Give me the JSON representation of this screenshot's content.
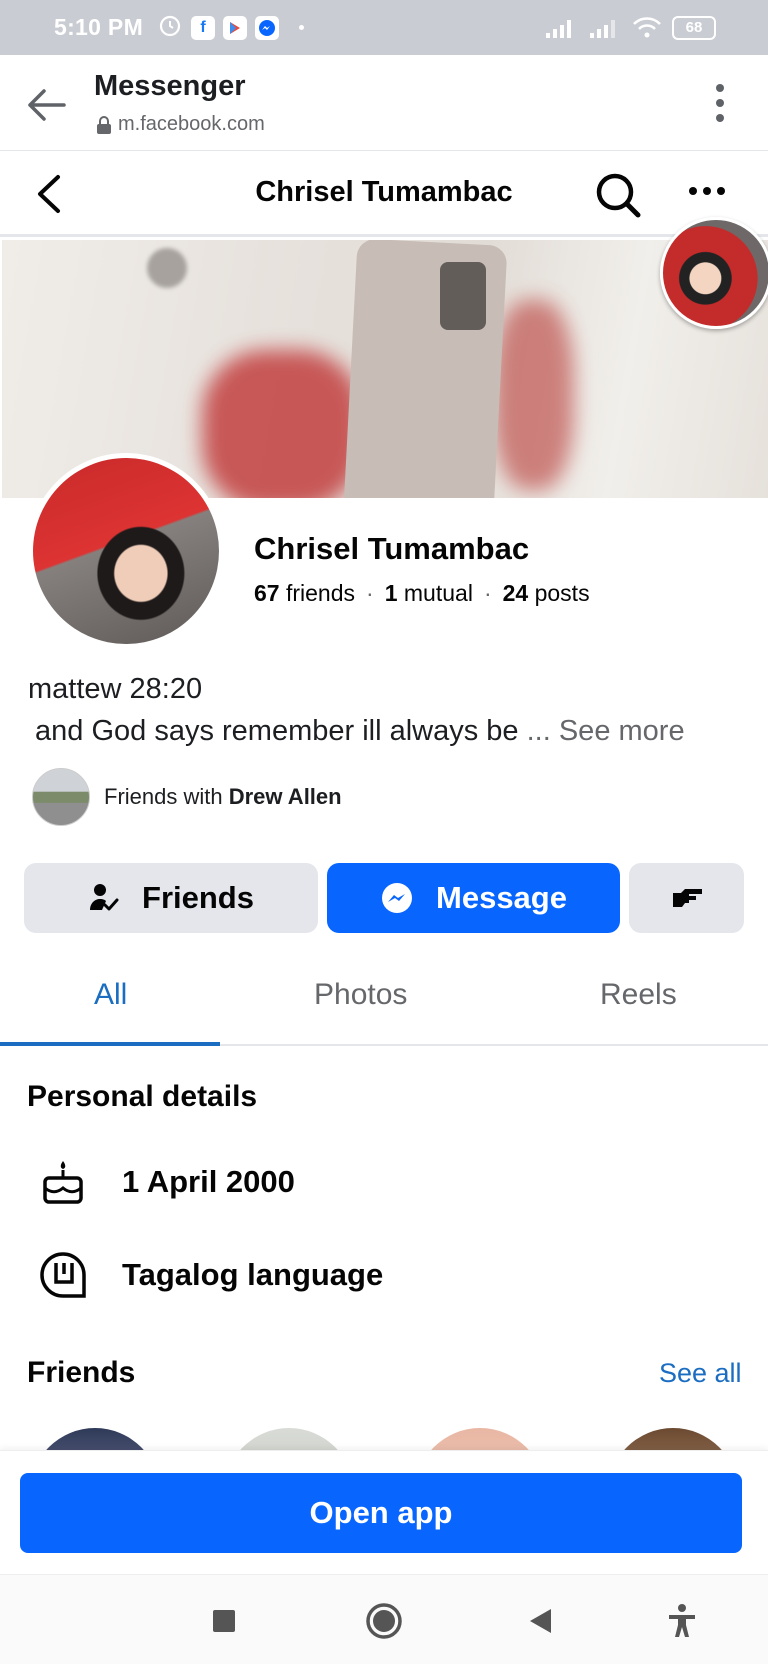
{
  "status_bar": {
    "time": "5:10 PM",
    "battery": "68",
    "notification_icons": [
      "alarm-icon",
      "facebook-icon",
      "play-store-icon",
      "messenger-icon"
    ]
  },
  "browser": {
    "title": "Messenger",
    "url": "m.facebook.com"
  },
  "nav": {
    "title": "Chrisel Tumambac"
  },
  "profile": {
    "name": "Chrisel Tumambac",
    "friends_count": "67",
    "friends_label": "friends",
    "mutual_count": "1",
    "mutual_label": "mutual",
    "posts_count": "24",
    "posts_label": "posts",
    "bio_line1": "mattew 28:20",
    "bio_line2": "and God says remember ill always be",
    "bio_ellipsis": "...",
    "see_more": "See more",
    "friends_with_prefix": "Friends with",
    "friends_with_name": "Drew Allen"
  },
  "actions": {
    "friends_label": "Friends",
    "message_label": "Message"
  },
  "tabs": [
    {
      "label": "All",
      "active": true
    },
    {
      "label": "Photos",
      "active": false
    },
    {
      "label": "Reels",
      "active": false
    }
  ],
  "personal_details": {
    "title": "Personal details",
    "birthday": "1 April 2000",
    "language": "Tagalog language"
  },
  "friends_section": {
    "title": "Friends",
    "see_all": "See all"
  },
  "open_app_label": "Open app",
  "colors": {
    "accent": "#0866ff",
    "link": "#1b6dc1",
    "button_gray": "#e4e6eb",
    "status_bar": "#c9ccd3"
  }
}
